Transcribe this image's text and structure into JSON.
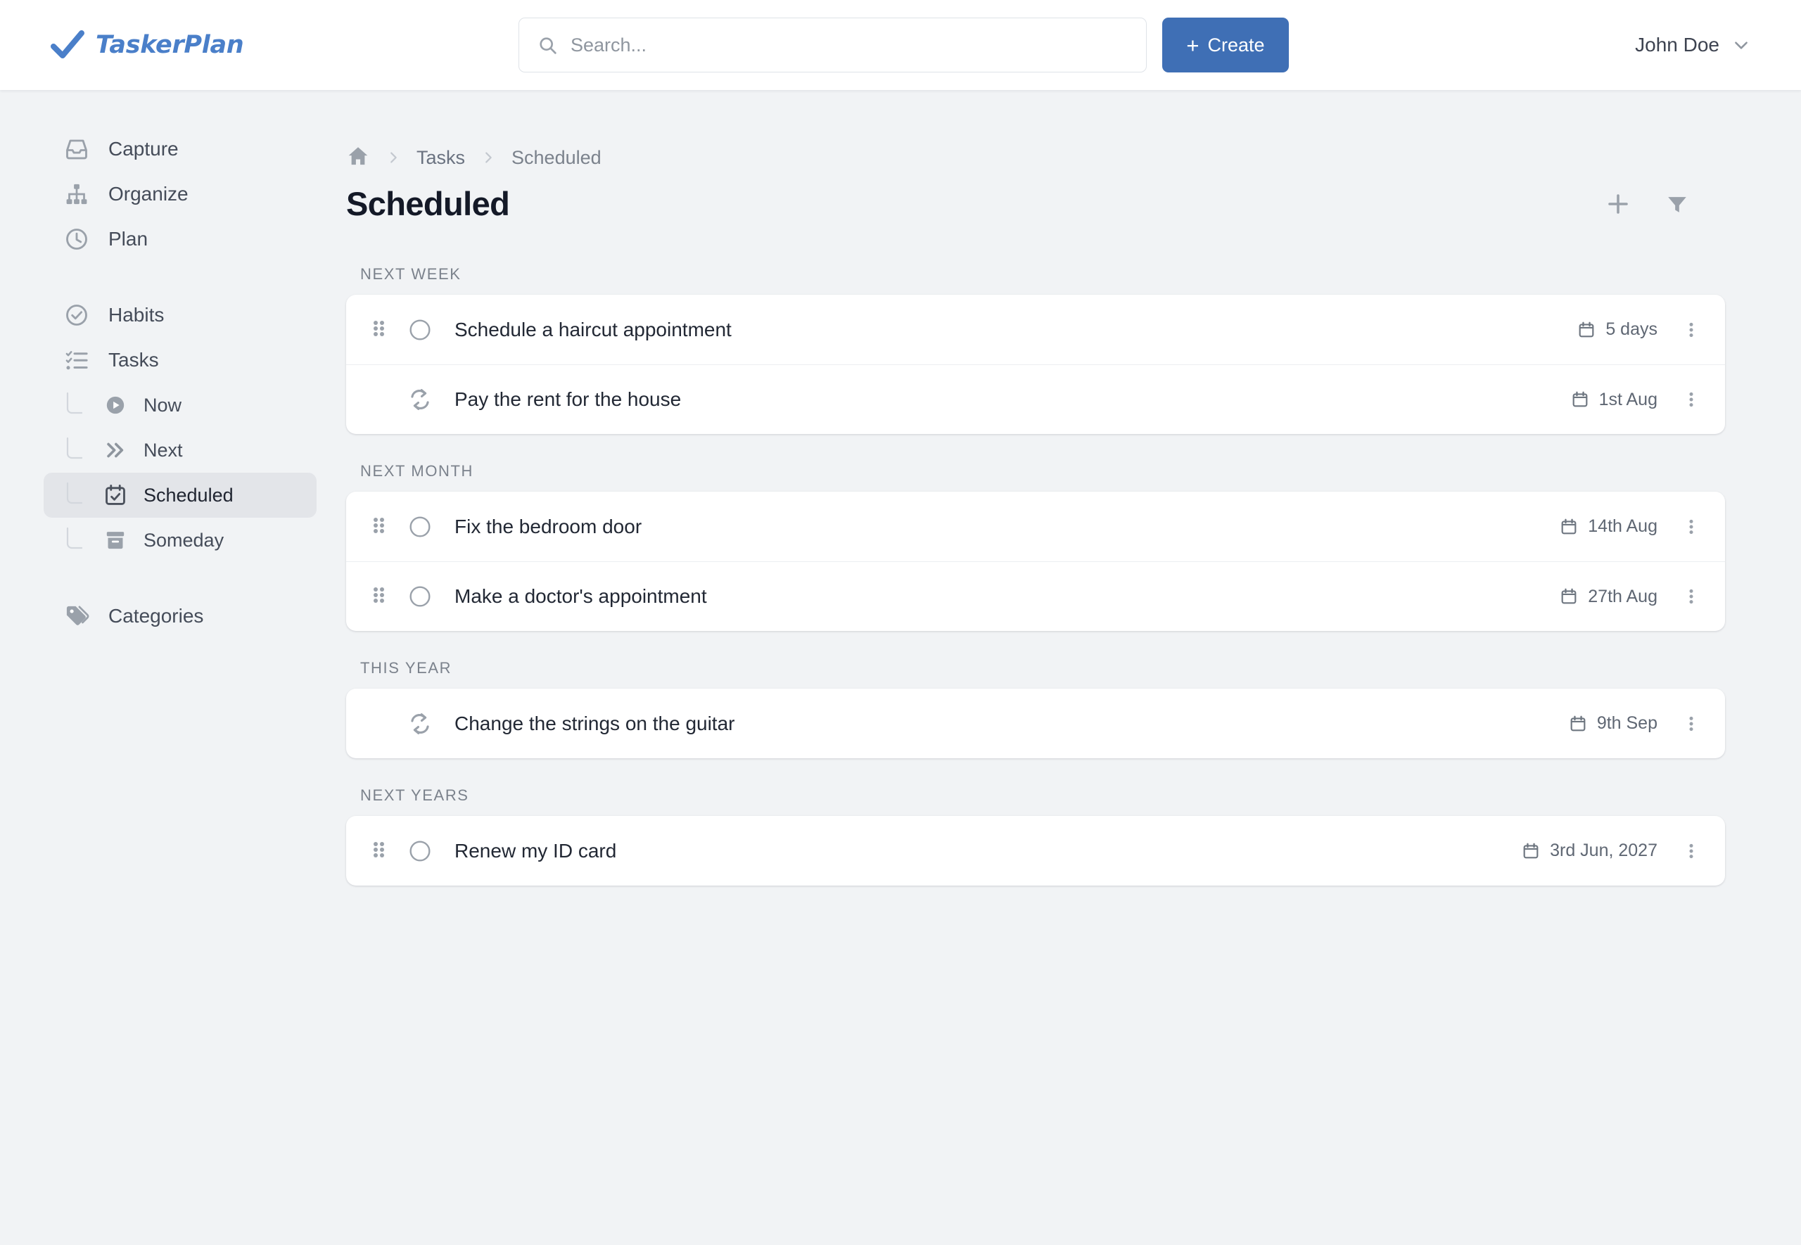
{
  "header": {
    "brand": "TaskerPlan",
    "brand_icon": "check-icon",
    "brand_color": "#4a7fc9",
    "search": {
      "placeholder": "Search...",
      "value": "",
      "icon": "search-icon"
    },
    "create_button": {
      "label": "Create",
      "icon": "plus-icon",
      "color": "#3f6fb5"
    },
    "user": {
      "name": "John Doe",
      "icon": "chevron-down-icon"
    }
  },
  "sidebar": {
    "primary": [
      {
        "label": "Capture",
        "icon": "inbox-icon"
      },
      {
        "label": "Organize",
        "icon": "sitemap-icon"
      },
      {
        "label": "Plan",
        "icon": "clock-icon"
      }
    ],
    "secondary": [
      {
        "label": "Habits",
        "icon": "check-circle-icon"
      },
      {
        "label": "Tasks",
        "icon": "checklist-icon"
      }
    ],
    "tasks_children": [
      {
        "label": "Now",
        "icon": "play-circle-icon",
        "active": false
      },
      {
        "label": "Next",
        "icon": "chevrons-right-icon",
        "active": false
      },
      {
        "label": "Scheduled",
        "icon": "calendar-check-icon",
        "active": true
      },
      {
        "label": "Someday",
        "icon": "archive-icon",
        "active": false
      }
    ],
    "tertiary": [
      {
        "label": "Categories",
        "icon": "tag-icon"
      }
    ]
  },
  "main": {
    "breadcrumb": {
      "home_icon": "home-icon",
      "items": [
        {
          "label": "Tasks"
        },
        {
          "label": "Scheduled"
        }
      ]
    },
    "title": "Scheduled",
    "actions": [
      {
        "name": "add",
        "icon": "plus-icon"
      },
      {
        "name": "filter",
        "icon": "filter-icon"
      }
    ],
    "sections": [
      {
        "label": "NEXT WEEK",
        "tasks": [
          {
            "title": "Schedule a haircut appointment",
            "date": "5 days",
            "leading_icon": "circle-checkbox-icon",
            "draggable": true,
            "recurring": false
          },
          {
            "title": "Pay the rent for the house",
            "date": "1st Aug",
            "leading_icon": "repeat-icon",
            "draggable": false,
            "recurring": true
          }
        ]
      },
      {
        "label": "NEXT MONTH",
        "tasks": [
          {
            "title": "Fix the bedroom door",
            "date": "14th Aug",
            "leading_icon": "circle-checkbox-icon",
            "draggable": true,
            "recurring": false
          },
          {
            "title": "Make a doctor's appointment",
            "date": "27th Aug",
            "leading_icon": "circle-checkbox-icon",
            "draggable": true,
            "recurring": false
          }
        ]
      },
      {
        "label": "THIS YEAR",
        "tasks": [
          {
            "title": "Change the strings on the guitar",
            "date": "9th Sep",
            "leading_icon": "repeat-icon",
            "draggable": false,
            "recurring": true
          }
        ]
      },
      {
        "label": "NEXT YEARS",
        "tasks": [
          {
            "title": "Renew my ID card",
            "date": "3rd Jun, 2027",
            "leading_icon": "circle-checkbox-icon",
            "draggable": true,
            "recurring": false
          }
        ]
      }
    ]
  }
}
